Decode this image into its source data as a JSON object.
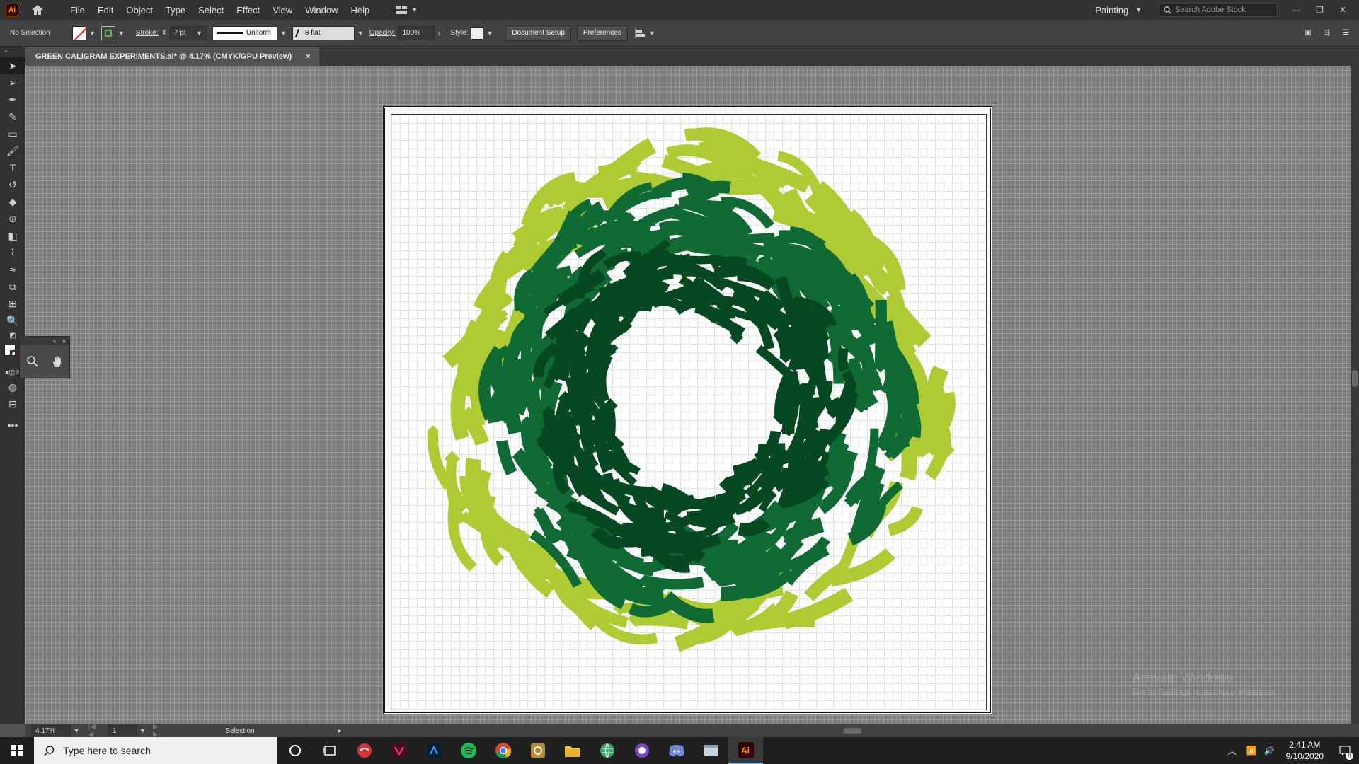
{
  "app": {
    "logo": "Ai",
    "workspace": "Painting",
    "search_placeholder": "Search Adobe Stock"
  },
  "menu": [
    "File",
    "Edit",
    "Object",
    "Type",
    "Select",
    "Effect",
    "View",
    "Window",
    "Help"
  ],
  "control_bar": {
    "selection_state": "No Selection",
    "stroke_label": "Stroke:",
    "stroke_weight": "7 pt",
    "profile": "Uniform",
    "brush": "8 flat",
    "opacity_label": "Opacity:",
    "opacity": "100%",
    "style_label": "Style:",
    "document_setup": "Document Setup",
    "preferences": "Preferences"
  },
  "document": {
    "tab_title": "GREEN CALIGRAM EXPERIMENTS.ai* @ 4.17% (CMYK/GPU Preview)",
    "close": "×"
  },
  "status_bar": {
    "zoom": "4.17%",
    "artboard_number": "1",
    "tool": "Selection"
  },
  "taskbar": {
    "search_placeholder": "Type here to search",
    "time": "2:41 AM",
    "date": "9/10/2020",
    "notifications": "8"
  },
  "watermark": {
    "line1": "Activate Windows",
    "line2": "Go to Settings to activate Windows."
  },
  "colors": {
    "light_green": "#aecb34",
    "mid_green": "#0f6a34",
    "dark_green": "#064821",
    "accent": "#ff9a00"
  }
}
